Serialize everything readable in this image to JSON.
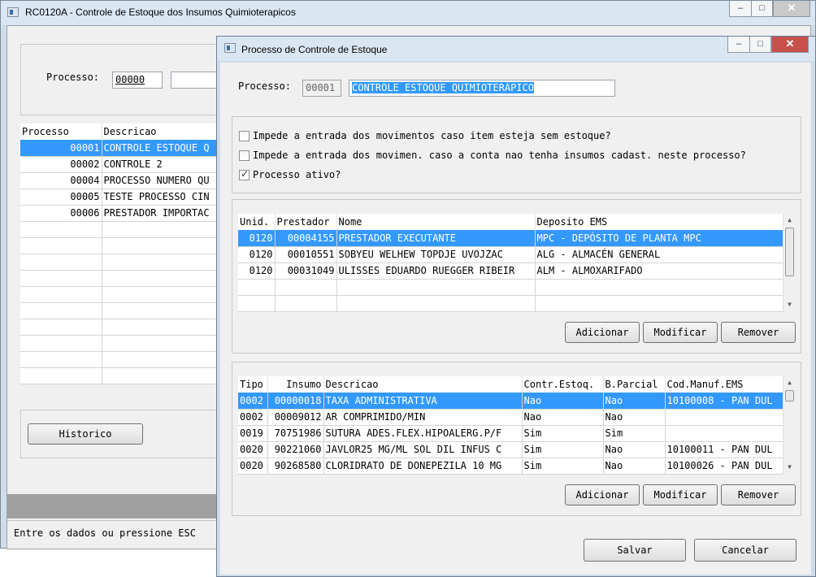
{
  "main_window": {
    "title": "RC0120A - Controle de Estoque dos Insumos Quimioterapicos",
    "process_label": "Processo:",
    "process_value": "00000",
    "columns": [
      "Processo",
      "Descricao"
    ],
    "rows": [
      {
        "code": "00001",
        "desc": "CONTROLE ESTOQUE Q",
        "selected": true
      },
      {
        "code": "00002",
        "desc": "CONTROLE 2"
      },
      {
        "code": "00004",
        "desc": "PROCESSO NUMERO QU"
      },
      {
        "code": "00005",
        "desc": "TESTE PROCESSO CIN"
      },
      {
        "code": "00006",
        "desc": "PRESTADOR IMPORTAC"
      }
    ],
    "historico_button": "Historico",
    "status_text": "Entre os dados ou pressione ESC"
  },
  "dialog": {
    "title": "Processo de Controle de Estoque",
    "process_label": "Processo:",
    "process_code": "00001",
    "process_desc": "CONTROLE ESTOQUE QUIMIOTERÁPICO",
    "checkboxes": [
      {
        "label": "Impede a entrada dos movimentos caso item esteja sem estoque?",
        "checked": false
      },
      {
        "label": "Impede a entrada dos movimen. caso a conta nao tenha insumos cadast. neste processo?",
        "checked": false
      },
      {
        "label": "Processo ativo?",
        "checked": true
      }
    ],
    "prestadores": {
      "columns": [
        "Unid.",
        "Prestador",
        "Nome",
        "Deposito EMS"
      ],
      "rows": [
        {
          "unid": "0120",
          "prestador": "00004155",
          "nome": "PRESTADOR EXECUTANTE",
          "deposito": "MPC - DEPÓSITO DE PLANTA MPC",
          "selected": true
        },
        {
          "unid": "0120",
          "prestador": "00010551",
          "nome": "SOBYEU WELHEW TOPDJE UVOJZAC",
          "deposito": "ALG - ALMACÉN GENERAL"
        },
        {
          "unid": "0120",
          "prestador": "00031049",
          "nome": "ULISSES EDUARDO RUEGGER RIBEIR",
          "deposito": "ALM - ALMOXARIFADO"
        }
      ],
      "buttons": {
        "add": "Adicionar",
        "modify": "Modificar",
        "remove": "Remover"
      }
    },
    "insumos": {
      "columns": [
        "Tipo",
        "Insumo",
        "Descricao",
        "Contr.Estoq.",
        "B.Parcial",
        "Cod.Manuf.EMS"
      ],
      "rows": [
        {
          "tipo": "0002",
          "insumo": "00000018",
          "descricao": "TAXA ADMINISTRATIVA",
          "contr": "Nao",
          "bparcial": "Nao",
          "cod": "10100008 - PAN DUL",
          "selected": true
        },
        {
          "tipo": "0002",
          "insumo": "00009012",
          "descricao": "AR COMPRIMIDO/MIN",
          "contr": "Nao",
          "bparcial": "Nao",
          "cod": ""
        },
        {
          "tipo": "0019",
          "insumo": "70751986",
          "descricao": "SUTURA ADES.FLEX.HIPOALERG.P/F",
          "contr": "Sim",
          "bparcial": "Sim",
          "cod": ""
        },
        {
          "tipo": "0020",
          "insumo": "90221060",
          "descricao": "JAVLOR25 MG/ML SOL DIL INFUS C",
          "contr": "Sim",
          "bparcial": "Nao",
          "cod": "10100011 - PAN DUL"
        },
        {
          "tipo": "0020",
          "insumo": "90268580",
          "descricao": "CLORIDRATO DE DONEPEZILA 10 MG",
          "contr": "Sim",
          "bparcial": "Nao",
          "cod": "10100026 - PAN DUL"
        }
      ],
      "buttons": {
        "add": "Adicionar",
        "modify": "Modificar",
        "remove": "Remover"
      }
    },
    "save_button": "Salvar",
    "cancel_button": "Cancelar"
  },
  "icons": {
    "window": "window-icon",
    "minimize": "minimize-icon",
    "maximize": "maximize-icon",
    "close": "close-icon",
    "scroll_up": "arrow-up-icon",
    "scroll_down": "arrow-down-icon"
  },
  "colors": {
    "selection": "#3399ff",
    "background": "#f0f0f0"
  }
}
